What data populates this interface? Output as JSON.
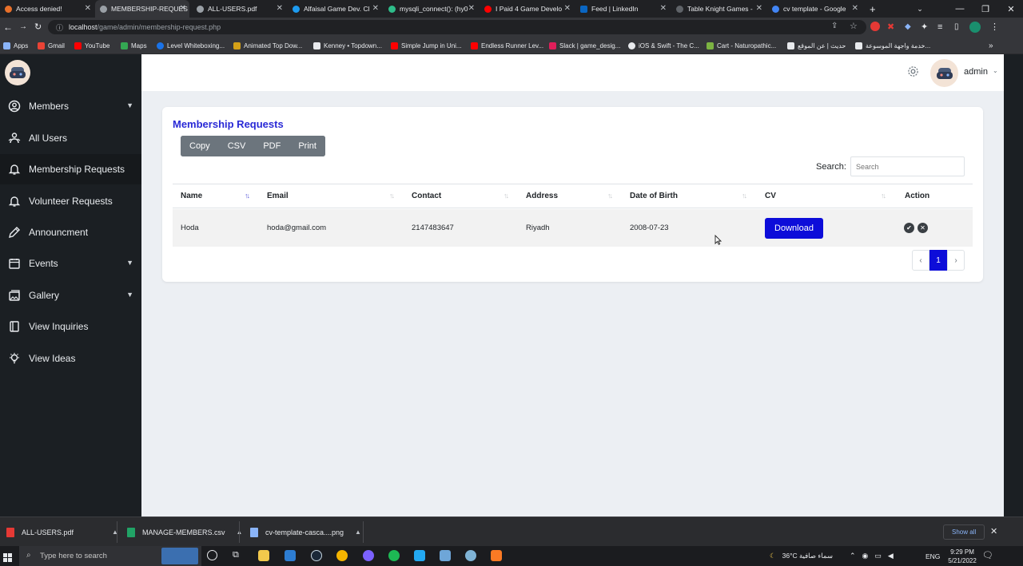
{
  "browser": {
    "tabs": [
      {
        "label": "Access denied!",
        "color": "#e8702a",
        "active": false
      },
      {
        "label": "MEMBERSHIP-REQUES",
        "color": "#9aa0a6",
        "active": true
      },
      {
        "label": "ALL-USERS.pdf",
        "color": "#9aa0a6",
        "active": false
      },
      {
        "label": "Alfaisal Game Dev. Cl",
        "color": "#1d9bf0",
        "active": false
      },
      {
        "label": "mysqli_connect(): (hy0",
        "color": "#2ebd8a",
        "active": false
      },
      {
        "label": "I Paid 4 Game Develo",
        "color": "#ff0000",
        "active": false
      },
      {
        "label": "Feed | LinkedIn",
        "color": "#0a66c2",
        "active": false
      },
      {
        "label": "Table Knight Games -",
        "color": "#5f6368",
        "active": false
      },
      {
        "label": "cv template - Google",
        "color": "#4285f4",
        "active": false
      }
    ],
    "new_tab": "+",
    "url_host": "localhost",
    "url_path": "/game/admin/membership-request.php",
    "bookmarks": [
      {
        "label": "Apps",
        "color": "#8ab4f8"
      },
      {
        "label": "Gmail",
        "color": "#ea4335"
      },
      {
        "label": "YouTube",
        "color": "#ff0000"
      },
      {
        "label": "Maps",
        "color": "#34a853"
      },
      {
        "label": "Level Whiteboxing...",
        "color": "#1a73e8"
      },
      {
        "label": "Animated Top Dow...",
        "color": "#d4a017"
      },
      {
        "label": "Kenney • Topdown...",
        "color": "#e8eaed"
      },
      {
        "label": "Simple Jump in Uni...",
        "color": "#ff0000"
      },
      {
        "label": "Endless Runner Lev...",
        "color": "#ff0000"
      },
      {
        "label": "Slack | game_desig...",
        "color": "#e01e5a"
      },
      {
        "label": "iOS & Swift - The C...",
        "color": "#e8eaed"
      },
      {
        "label": "Cart - Naturopathic...",
        "color": "#7cb342"
      },
      {
        "label": "حديث | عن الموقع",
        "color": "#e8eaed"
      },
      {
        "label": "خدمة واجهة الموسوعة...",
        "color": "#e8eaed"
      }
    ]
  },
  "sidebar": {
    "items": [
      {
        "label": "Members",
        "icon": "user-circle-icon",
        "has_children": true
      },
      {
        "label": "All Users",
        "icon": "users-icon",
        "has_children": false
      },
      {
        "label": "Membership Requests",
        "icon": "bell-icon",
        "has_children": false
      },
      {
        "label": "Volunteer Requests",
        "icon": "bell-icon",
        "has_children": false
      },
      {
        "label": "Announcment",
        "icon": "pencil-icon",
        "has_children": false
      },
      {
        "label": "Events",
        "icon": "calendar-icon",
        "has_children": true
      },
      {
        "label": "Gallery",
        "icon": "image-icon",
        "has_children": true
      },
      {
        "label": "View Inquiries",
        "icon": "book-icon",
        "has_children": false
      },
      {
        "label": "View Ideas",
        "icon": "lightbulb-icon",
        "has_children": false
      }
    ]
  },
  "header": {
    "username": "admin"
  },
  "card": {
    "title": "Membership Requests",
    "export_buttons": [
      "Copy",
      "CSV",
      "PDF",
      "Print"
    ],
    "search_label": "Search:",
    "search_placeholder": "Search"
  },
  "table": {
    "columns": [
      "Name",
      "Email",
      "Contact",
      "Address",
      "Date of Birth",
      "CV",
      "Action"
    ],
    "rows": [
      {
        "name": "Hoda",
        "email": "hoda@gmail.com",
        "contact": "2147483647",
        "address": "Riyadh",
        "dob": "2008-07-23",
        "cv_button": "Download"
      }
    ]
  },
  "pagination": {
    "prev": "‹",
    "current": "1",
    "next": "›"
  },
  "downloads": {
    "items": [
      {
        "label": "ALL-USERS.pdf",
        "color": "#e53935"
      },
      {
        "label": "MANAGE-MEMBERS.csv",
        "color": "#21a366"
      },
      {
        "label": "cv-template-casca....png",
        "color": "#8ab4f8"
      }
    ],
    "show_all": "Show all"
  },
  "taskbar": {
    "search_placeholder": "Type here to search",
    "weather": "36°C  سماء صافية",
    "language": "ENG",
    "time": "9:29 PM",
    "date": "5/21/2022"
  },
  "colors": {
    "accent": "#0d0dd9",
    "title": "#2a2ad6",
    "sidebar_bg": "#1b1f23"
  }
}
